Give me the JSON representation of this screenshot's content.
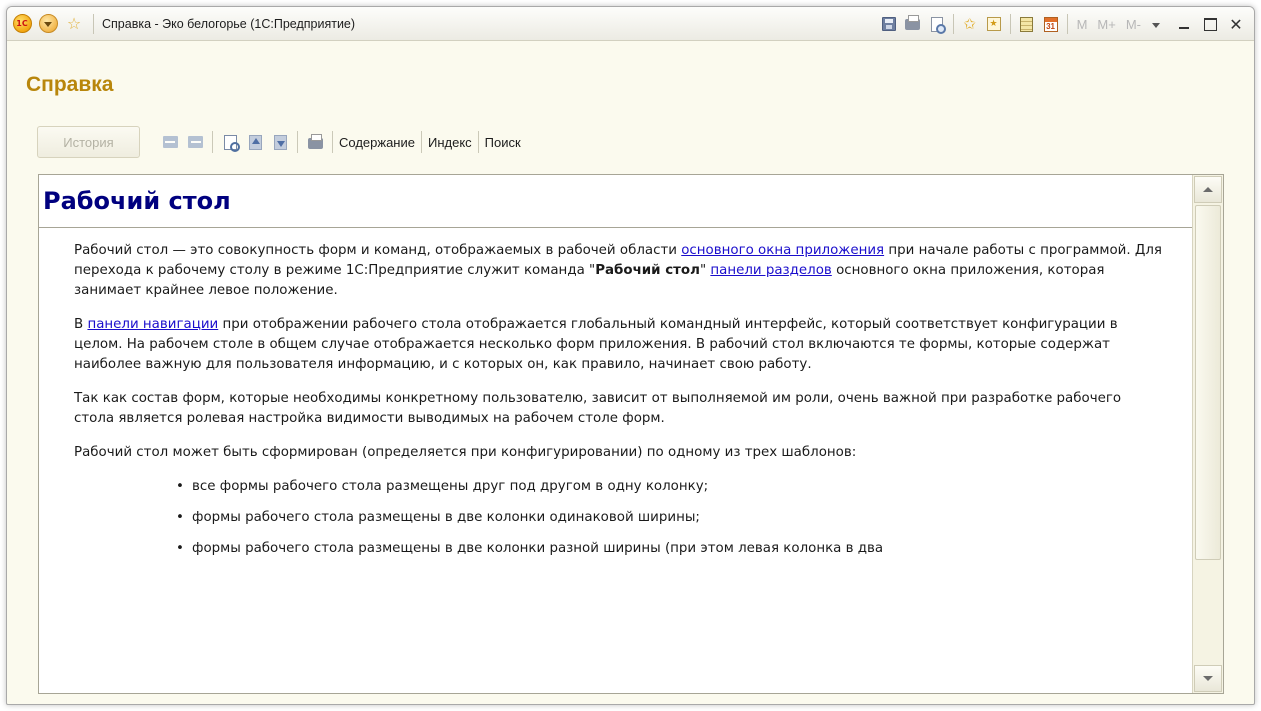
{
  "window": {
    "title": "Справка - Эко белогорье  (1С:Предприятие)",
    "logo_text": "1С",
    "memory_buttons": [
      "M",
      "M+",
      "M-"
    ]
  },
  "header": {
    "title": "Справка"
  },
  "toolbar": {
    "history_label": "История",
    "links": [
      "Содержание",
      "Индекс",
      "Поиск"
    ]
  },
  "document": {
    "title": "Рабочий стол",
    "p1": {
      "t1": "Рабочий стол — это совокупность форм и команд, отображаемых в рабочей области ",
      "link1": "основного окна приложения",
      "t2": " при начале работы с программой. Для перехода к рабочему столу в режиме 1С:Предприятие служит команда \"",
      "bold": "Рабочий стол",
      "t3": "\" ",
      "link2": "панели разделов",
      "t4": " основного окна приложения, которая занимает крайнее левое положение."
    },
    "p2": {
      "t1": "В ",
      "link": "панели навигации",
      "t2": " при отображении рабочего стола отображается глобальный командный интерфейс, который соответствует конфигурации в целом. На рабочем столе в общем случае отображается несколько форм приложения. В рабочий стол включаются те формы, которые содержат наиболее важную для пользователя информацию, и с которых он, как правило, начинает свою работу."
    },
    "p3": "Так как состав форм, которые необходимы конкретному пользователю, зависит от выполняемой им роли, очень важной при разработке рабочего стола является ролевая настройка видимости выводимых на рабочем столе форм.",
    "p4": "Рабочий стол может быть сформирован (определяется при конфигурировании) по одному из трех шаблонов:",
    "bullets": [
      "все формы рабочего стола размещены друг под другом в одну колонку;",
      "формы рабочего стола размещены в две колонки одинаковой ширины;",
      "формы рабочего стола размещены в две колонки разной ширины (при этом левая колонка в два"
    ]
  },
  "colors": {
    "header_title": "#b8860b",
    "doc_title": "#00007f",
    "link": "#1a0dcc",
    "window_bg": "#fbfaee"
  }
}
